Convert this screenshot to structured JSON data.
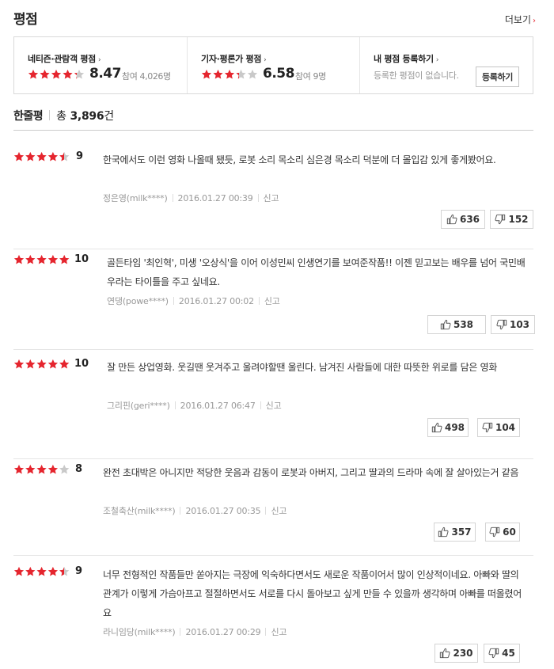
{
  "header": {
    "title": "평점",
    "more_label": "더보기"
  },
  "summary": {
    "netizen": {
      "title": "네티즌·관람객 평점",
      "score": "8.47",
      "participants": "참여 4,026명",
      "rating": 4.235
    },
    "critic": {
      "title": "기자·평론가 평점",
      "score": "6.58",
      "participants": "참여 9명",
      "rating": 3.29
    },
    "mine": {
      "title": "내 평점 등록하기",
      "empty_text": "등록한 평점이 없습니다.",
      "button_label": "등록하기"
    }
  },
  "comments": {
    "label": "한줄평",
    "total_prefix": "총",
    "total_count": "3,896",
    "total_suffix": "건"
  },
  "colors": {
    "accent": "#e5252e",
    "star_empty": "#c9c9c9"
  },
  "reviews": [
    {
      "rating": 4.5,
      "score": "9",
      "text": "한국에서도 이런 영화 나올때 됐듯, 로봇 소리 목소리 심은경 목소리 덕분에 더 몰입감 있게 좋게봤어요.",
      "author": "정은영(milk****)",
      "date": "2016.01.27 00:39",
      "report": "신고",
      "likes": "636",
      "dislikes": "152"
    },
    {
      "rating": 5,
      "score": "10",
      "text": "골든타임 '최인혁', 미생 '오상식'을 이어 이성민씨 인생연기를 보여준작품!! 이젠 믿고보는 배우를 넘어 국민배우라는 타이틀을 주고 싶네요.",
      "author": "연댕(powe****)",
      "date": "2016.01.27 00:02",
      "report": "신고",
      "likes": "538",
      "dislikes": "103"
    },
    {
      "rating": 5,
      "score": "10",
      "text": "잘 만든 상업영화. 웃길땐 웃겨주고 울려야할땐 울린다. 남겨진 사람들에 대한 따뜻한 위로를 담은 영화",
      "author": "그리핀(geri****)",
      "date": "2016.01.27 06:47",
      "report": "신고",
      "likes": "498",
      "dislikes": "104"
    },
    {
      "rating": 4,
      "score": "8",
      "text": "완전 초대박은 아니지만 적당한 웃음과 감동이 로봇과 아버지, 그리고 딸과의 드라마 속에 잘 살아있는거 같음",
      "author": "조철축산(milk****)",
      "date": "2016.01.27 00:35",
      "report": "신고",
      "likes": "357",
      "dislikes": "60"
    },
    {
      "rating": 4.5,
      "score": "9",
      "text": "너무 전형적인 작품들만 쏟아지는 극장에 익숙하다면서도 새로운 작품이어서 많이 인상적이네요. 아빠와 딸의 관계가 이렇게 가슴아프고 절절하면서도 서로를 다시 돌아보고 싶게 만들 수 있을까 생각하며 아빠를 떠올렸어요",
      "author": "라니임당(milk****)",
      "date": "2016.01.27 00:29",
      "report": "신고",
      "likes": "230",
      "dislikes": "45"
    }
  ]
}
